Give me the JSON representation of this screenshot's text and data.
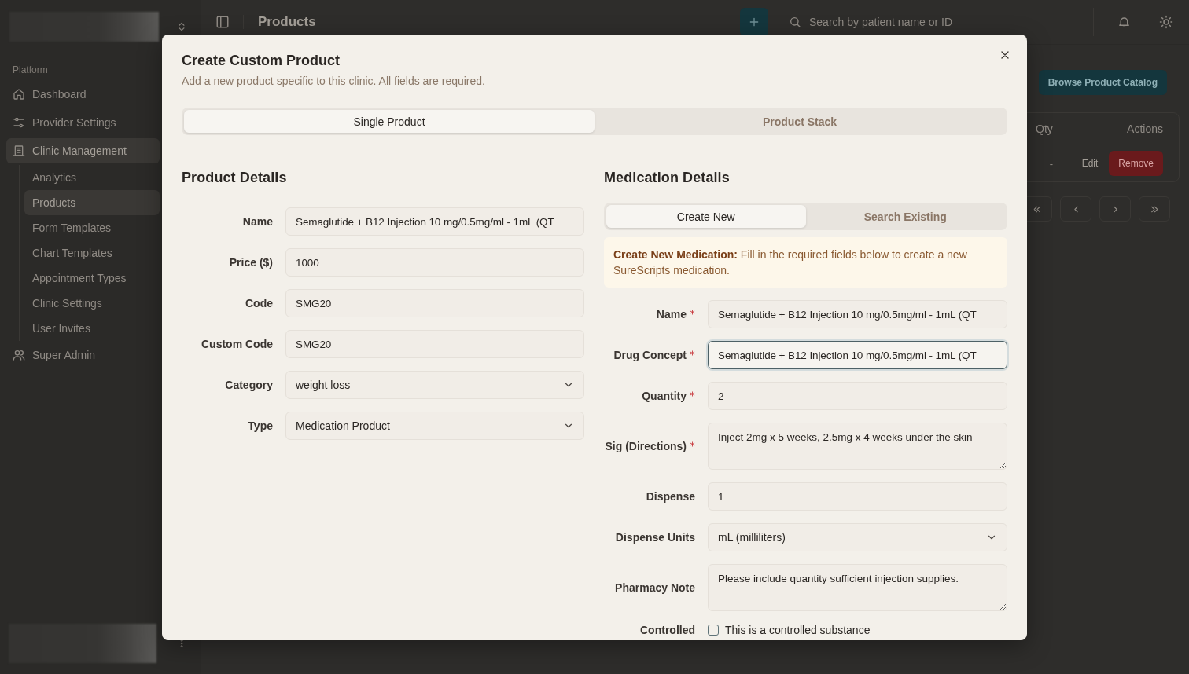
{
  "sidebar": {
    "section_label": "Platform",
    "items": [
      {
        "label": "Dashboard",
        "active": false
      },
      {
        "label": "Provider Settings",
        "active": false
      },
      {
        "label": "Clinic Management",
        "active": true,
        "children": [
          {
            "label": "Analytics",
            "selected": false
          },
          {
            "label": "Products",
            "selected": true
          },
          {
            "label": "Form Templates",
            "selected": false
          },
          {
            "label": "Chart Templates",
            "selected": false
          },
          {
            "label": "Appointment Types",
            "selected": false
          },
          {
            "label": "Clinic Settings",
            "selected": false
          },
          {
            "label": "User Invites",
            "selected": false
          }
        ]
      },
      {
        "label": "Super Admin",
        "active": false
      }
    ]
  },
  "topbar": {
    "title": "Products",
    "search": {
      "placeholder": "Search by patient name or ID"
    }
  },
  "page": {
    "catalog_button": "Browse Product Catalog",
    "table": {
      "columns": [
        "Qty",
        "Actions"
      ],
      "rows": [
        {
          "qty": "-",
          "edit": "Edit",
          "remove": "Remove"
        }
      ]
    }
  },
  "modal": {
    "title": "Create Custom Product",
    "subtitle": "Add a new product specific to this clinic. All fields are required.",
    "tabs": [
      {
        "label": "Single Product",
        "selected": true
      },
      {
        "label": "Product Stack",
        "selected": false
      }
    ],
    "product_details": {
      "heading": "Product Details",
      "fields": [
        {
          "label": "Name",
          "kind": "text",
          "value": "Semaglutide + B12 Injection 10 mg/0.5mg/ml - 1mL (QT"
        },
        {
          "label": "Price ($)",
          "kind": "text",
          "value": "1000"
        },
        {
          "label": "Code",
          "kind": "text",
          "value": "SMG20"
        },
        {
          "label": "Custom Code",
          "kind": "text",
          "value": "SMG20"
        },
        {
          "label": "Category",
          "kind": "select",
          "value": "weight loss"
        },
        {
          "label": "Type",
          "kind": "select",
          "value": "Medication Product"
        }
      ]
    },
    "medication_details": {
      "heading": "Medication Details",
      "tabs": [
        {
          "label": "Create New",
          "selected": true
        },
        {
          "label": "Search Existing",
          "selected": false
        }
      ],
      "notice": "**Create New Medication:** Fill in the required fields below to create a new SureScripts medication.",
      "fields": [
        {
          "label": "Name",
          "kind": "text",
          "required": true,
          "focused": false,
          "value": "Semaglutide + B12 Injection 10 mg/0.5mg/ml - 1mL (QT"
        },
        {
          "label": "Drug Concept",
          "kind": "text",
          "required": true,
          "focused": true,
          "value": "Semaglutide + B12 Injection 10 mg/0.5mg/ml - 1mL (QT"
        },
        {
          "label": "Quantity",
          "kind": "text",
          "required": true,
          "focused": false,
          "value": "2"
        },
        {
          "label": "Sig (Directions)",
          "kind": "textarea",
          "required": true,
          "focused": false,
          "value": "Inject 2mg x 5 weeks, 2.5mg x 4 weeks under the skin"
        },
        {
          "label": "Dispense",
          "kind": "text",
          "required": false,
          "focused": false,
          "value": "1"
        },
        {
          "label": "Dispense Units",
          "kind": "select",
          "required": false,
          "focused": false,
          "value": "mL (milliliters)"
        },
        {
          "label": "Pharmacy Note",
          "kind": "textarea",
          "required": false,
          "focused": false,
          "value": "Please include quantity sufficient injection supplies."
        },
        {
          "label": "Controlled",
          "kind": "checkbox",
          "required": false,
          "checked": false,
          "text": "This is a controlled substance"
        }
      ]
    }
  }
}
